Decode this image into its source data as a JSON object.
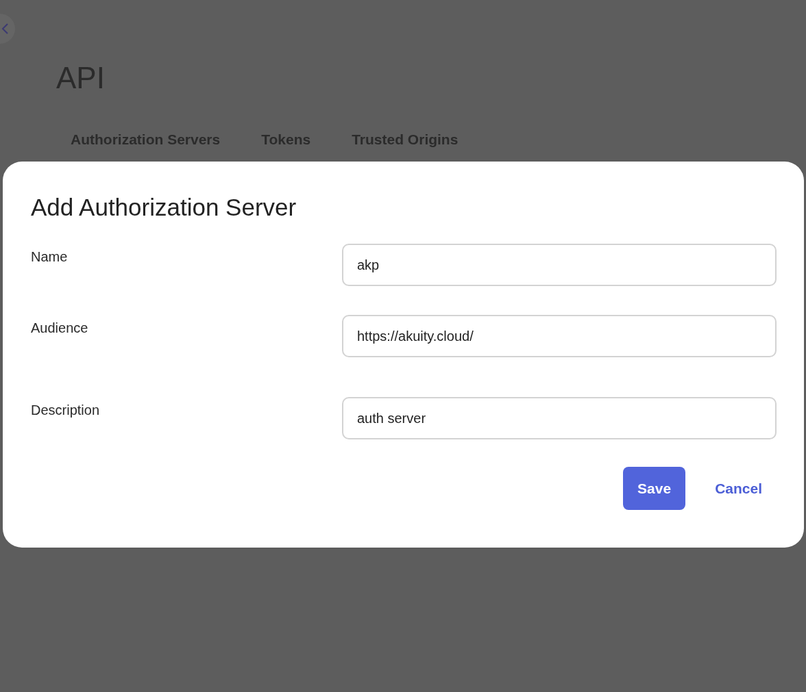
{
  "page": {
    "title": "API"
  },
  "tabs": [
    {
      "label": "Authorization Servers"
    },
    {
      "label": "Tokens"
    },
    {
      "label": "Trusted Origins"
    }
  ],
  "dialog": {
    "title": "Add Authorization Server",
    "fields": [
      {
        "label": "Name",
        "value": "akp"
      },
      {
        "label": "Audience",
        "value": "https://akuity.cloud/"
      },
      {
        "label": "Description",
        "value": "auth server"
      }
    ],
    "buttons": [
      {
        "label": "Save",
        "kind": "primary"
      },
      {
        "label": "Cancel",
        "kind": "link"
      }
    ]
  }
}
